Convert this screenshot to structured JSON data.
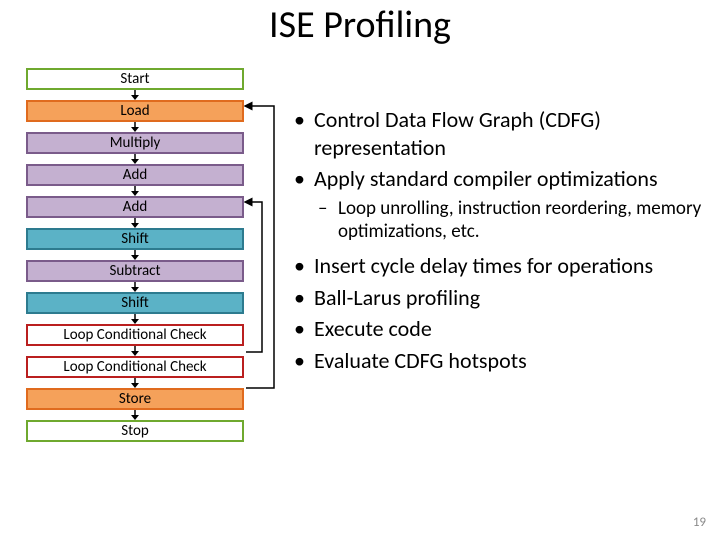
{
  "title": "ISE Profiling",
  "diagram": {
    "nodes": [
      {
        "label": "Start",
        "style": "green"
      },
      {
        "label": "Load",
        "style": "orange"
      },
      {
        "label": "Multiply",
        "style": "plum"
      },
      {
        "label": "Add",
        "style": "plum"
      },
      {
        "label": "Add",
        "style": "plum"
      },
      {
        "label": "Shift",
        "style": "teal"
      },
      {
        "label": "Subtract",
        "style": "plum"
      },
      {
        "label": "Shift",
        "style": "teal"
      },
      {
        "label": "Loop Conditional Check",
        "style": "red"
      },
      {
        "label": "Loop Conditional Check",
        "style": "red"
      },
      {
        "label": "Store",
        "style": "orange"
      },
      {
        "label": "Stop",
        "style": "green"
      }
    ]
  },
  "bullets": {
    "items": [
      {
        "level": 1,
        "text": "Control Data Flow Graph (CDFG) representation"
      },
      {
        "level": 1,
        "text": "Apply standard compiler optimizations"
      },
      {
        "level": 2,
        "text": "Loop unrolling, instruction reordering, memory optimizations, etc."
      },
      {
        "level": 1,
        "text": "Insert cycle delay times for operations"
      },
      {
        "level": 1,
        "text": "Ball-Larus profiling"
      },
      {
        "level": 1,
        "text": "Execute code"
      },
      {
        "level": 1,
        "text": "Evaluate CDFG hotspots"
      }
    ]
  },
  "page_number": "19"
}
